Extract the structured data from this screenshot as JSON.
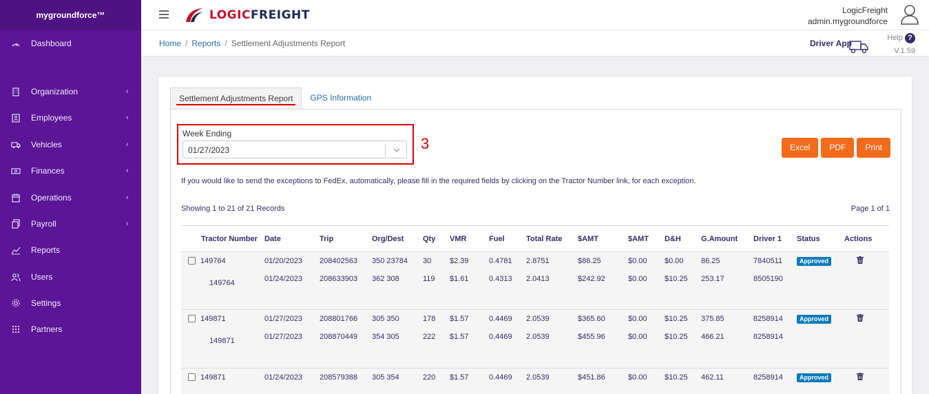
{
  "sidebar": {
    "brand": "mygroundforce™",
    "items": [
      {
        "label": "Dashboard",
        "icon": "dashboard-icon",
        "chevron": false
      },
      {
        "label": "Organization",
        "icon": "building-icon",
        "chevron": true
      },
      {
        "label": "Employees",
        "icon": "id-badge-icon",
        "chevron": true
      },
      {
        "label": "Vehicles",
        "icon": "truck-icon",
        "chevron": true
      },
      {
        "label": "Finances",
        "icon": "money-icon",
        "chevron": true
      },
      {
        "label": "Operations",
        "icon": "calendar-icon",
        "chevron": true
      },
      {
        "label": "Payroll",
        "icon": "copy-icon",
        "chevron": true
      },
      {
        "label": "Reports",
        "icon": "chart-icon",
        "chevron": false
      },
      {
        "label": "Users",
        "icon": "users-icon",
        "chevron": false
      },
      {
        "label": "Settings",
        "icon": "gear-icon",
        "chevron": false
      },
      {
        "label": "Partners",
        "icon": "grid-icon",
        "chevron": false
      }
    ],
    "chevron_glyph": "‹"
  },
  "header": {
    "logo_part1": "LOGIC",
    "logo_part2": "FREIGHT",
    "user_name": "LogicFreight",
    "user_account": "admin.mygroundforce"
  },
  "breadcrumb": {
    "home": "Home",
    "reports": "Reports",
    "current": "Settlement Adjustments Report",
    "sep": "/"
  },
  "toolbar": {
    "driver_app": "Driver App",
    "help": "Help",
    "help_glyph": "?",
    "version": "V.1.59"
  },
  "tabs": [
    {
      "label": "Settlement Adjustments Report"
    },
    {
      "label": "GPS Information"
    }
  ],
  "filter": {
    "week_label": "Week Ending",
    "week_value": "01/27/2023",
    "annotation": "3"
  },
  "buttons": {
    "excel": "Excel",
    "pdf": "PDF",
    "print": "Print"
  },
  "info_text": "If you would like to send the exceptions to FedEx, automatically, please fill in the required fields by clicking on the Tractor Number link, for each exception.",
  "showing_text": "Showing 1 to 21 of 21 Records",
  "page_text": "Page 1 of 1",
  "table": {
    "headers": [
      "Tractor Number",
      "Date",
      "Trip",
      "Org/Dest",
      "Qty",
      "VMR",
      "Fuel",
      "Total Rate",
      "$AMT",
      "$AMT",
      "D&H",
      "G.Amount",
      "Driver 1",
      "Status",
      "Actions"
    ],
    "groups": [
      {
        "status": "Approved",
        "rows": [
          {
            "tractor": "149764",
            "date": "01/20/2023",
            "trip": "208402563",
            "org": "350 23784",
            "qty": "30",
            "vmr": "$2.39",
            "fuel": "0.4781",
            "rate": "2.8751",
            "amt1": "$86.25",
            "amt2": "$0.00",
            "dh": "$0.00",
            "gamt": "86.25",
            "driver": "7840511"
          },
          {
            "tractor": "149764",
            "date": "01/24/2023",
            "trip": "208633903",
            "org": "362 308",
            "qty": "119",
            "vmr": "$1.61",
            "fuel": "0.4313",
            "rate": "2.0413",
            "amt1": "$242.92",
            "amt2": "$0.00",
            "dh": "$10.25",
            "gamt": "253.17",
            "driver": "8505190"
          }
        ]
      },
      {
        "status": "Approved",
        "rows": [
          {
            "tractor": "149871",
            "date": "01/27/2023",
            "trip": "208801766",
            "org": "305 350",
            "qty": "178",
            "vmr": "$1.57",
            "fuel": "0.4469",
            "rate": "2.0539",
            "amt1": "$365.60",
            "amt2": "$0.00",
            "dh": "$10.25",
            "gamt": "375.85",
            "driver": "8258914"
          },
          {
            "tractor": "149871",
            "date": "01/27/2023",
            "trip": "208870449",
            "org": "354 305",
            "qty": "222",
            "vmr": "$1.57",
            "fuel": "0.4469",
            "rate": "2.0539",
            "amt1": "$455.96",
            "amt2": "$0.00",
            "dh": "$10.25",
            "gamt": "466.21",
            "driver": "8258914"
          }
        ]
      },
      {
        "status": "Approved",
        "rows": [
          {
            "tractor": "149871",
            "date": "01/24/2023",
            "trip": "208579388",
            "org": "305 354",
            "qty": "220",
            "vmr": "$1.57",
            "fuel": "0.4469",
            "rate": "2.0539",
            "amt1": "$451.86",
            "amt2": "$0.00",
            "dh": "$10.25",
            "gamt": "462.11",
            "driver": "8258914"
          }
        ]
      }
    ]
  }
}
